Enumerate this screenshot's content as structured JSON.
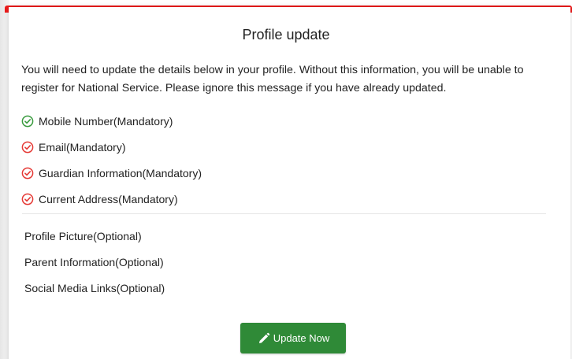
{
  "modal": {
    "title": "Profile update",
    "intro": "You will need to update the details below in your profile. Without this information, you will be unable to register for National Service. Please ignore this message if you have already updated.",
    "accent_color": "#ee1b1b"
  },
  "required_items": [
    {
      "label": "Mobile Number(Mandatory)",
      "status": "complete",
      "icon": "check-circle-icon",
      "color": "#3a9b3f"
    },
    {
      "label": "Email(Mandatory)",
      "status": "incomplete",
      "icon": "check-circle-icon",
      "color": "#e53935"
    },
    {
      "label": "Guardian Information(Mandatory)",
      "status": "incomplete",
      "icon": "check-circle-icon",
      "color": "#e53935"
    },
    {
      "label": "Current Address(Mandatory)",
      "status": "incomplete",
      "icon": "check-circle-icon",
      "color": "#e53935"
    }
  ],
  "optional_items": [
    {
      "label": "Profile Picture(Optional)"
    },
    {
      "label": "Parent Information(Optional)"
    },
    {
      "label": "Social Media Links(Optional)"
    }
  ],
  "actions": {
    "update_label": "Update Now",
    "update_icon": "pencil-icon",
    "update_color": "#2f8a37"
  }
}
